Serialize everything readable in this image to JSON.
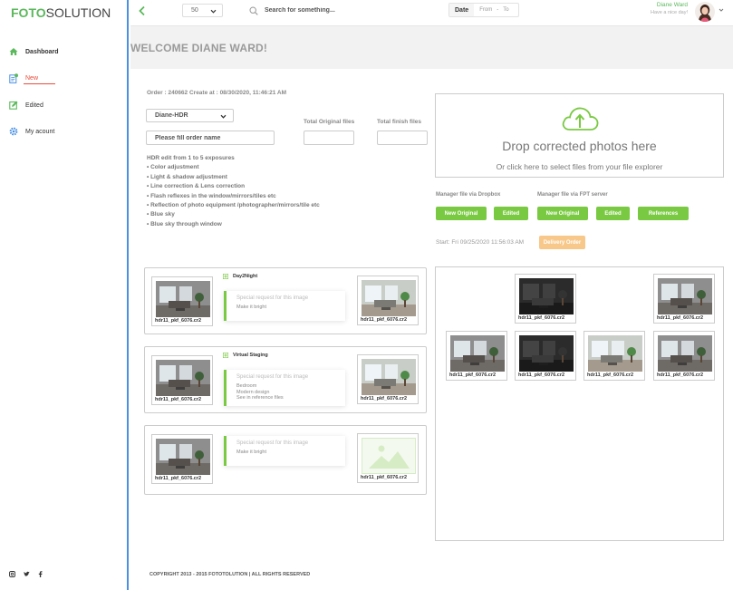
{
  "brand": {
    "part1": "FOTO",
    "part2": "SOLUTION"
  },
  "nav": [
    {
      "label": "Dashboard"
    },
    {
      "label": "New"
    },
    {
      "label": "Edited"
    },
    {
      "label": "My acount"
    }
  ],
  "header": {
    "page_size": "50",
    "search_placeholder": "Search for something...",
    "date_label": "Date",
    "date_from": "From",
    "date_sep": "-",
    "date_to": "To",
    "user_name": "Diane Ward",
    "user_greeting": "Have a nice day!"
  },
  "welcome": "WELCOME DIANE WARD!",
  "order": {
    "title": "Order : 240662 Create at : 08/30/2020, 11:46:21 AM",
    "preset": "Diane-HDR",
    "name_placeholder": "Please fill order name",
    "total_original_label": "Total Original files",
    "total_finish_label": "Total finish files",
    "features": [
      "HDR edit from 1 to 5 exposures",
      "• Color adjustment",
      "• Light & shadow adjustment",
      "• Line correction & Lens correction",
      "• Flash reflexes in the window/mirrors/tiles etc",
      "• Reflection of photo equipment /photographer/mirrors/tile etc",
      "• Blue sky",
      "• Blue sky through window"
    ]
  },
  "upload": {
    "title": "Drop corrected photos here",
    "subtitle": "Or click here to select files from your file explorer",
    "dropbox_label": "Manager file via Dropbox",
    "ftp_label": "Manager file via FPT server",
    "btn_new_original_1": "New Original",
    "btn_edited_1": "Edited",
    "btn_new_original_2": "New Original",
    "btn_edited_2": "Edited",
    "btn_references": "References",
    "start_text": "Start: Fri 09/25/2020 11:56:03 AM",
    "delivery_label": "Delivery Order"
  },
  "requests": [
    {
      "service": "Day2Night",
      "placeholder": "Special request for this image",
      "note": "Make it bright",
      "original_file": "hdr11_pkf_6076.cr2",
      "result_file": "hdr11_pkf_6076.cr2"
    },
    {
      "service": "Virtual Staging",
      "placeholder": "Special request for this image",
      "note": "Bedroom\nModern design\nSee in reference files",
      "original_file": "hdr11_pkf_6076.cr2",
      "result_file": "hdr11_pkf_6076.cr2"
    },
    {
      "service": "",
      "placeholder": "Special request for this image",
      "note": "Make it bright",
      "original_file": "hdr11_pkf_6076.cr2",
      "result_file": "hdr11_pkf_6076.cr2"
    }
  ],
  "gallery": [
    {
      "file": "hdr11_pkf_6076.cr2",
      "tone": "dark"
    },
    {
      "file": "hdr11_pkf_6076.cr2",
      "tone": "mid"
    },
    {
      "file": "hdr11_pkf_6076.cr2",
      "tone": "mid"
    },
    {
      "file": "hdr11_pkf_6076.cr2",
      "tone": "dark"
    },
    {
      "file": "hdr11_pkf_6076.cr2",
      "tone": "light"
    },
    {
      "file": "hdr11_pkf_6076.cr2",
      "tone": "mid"
    }
  ],
  "footer": "COPYRIGHT 2013 - 2015 FOTOTOLUTION  |  ALL RIGHTS RESERVED",
  "colors": {
    "accent": "#7ac943",
    "sidebar_border": "#4a90e2",
    "new_nav": "#e74c3c",
    "delivery": "#f8c88a"
  }
}
